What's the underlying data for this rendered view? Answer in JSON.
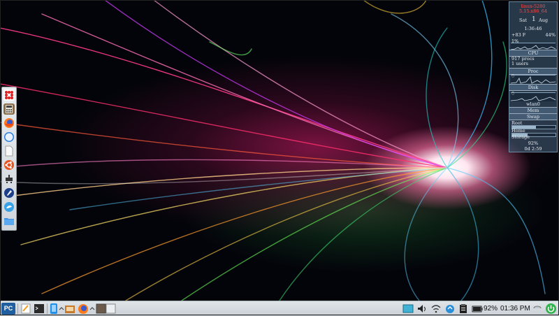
{
  "system_monitor": {
    "hostname": "linux-5280",
    "kernel": "5.15.x86_64",
    "day": "Sat",
    "date_num": "1",
    "month": "Aug",
    "time": "1:36:46",
    "temperature": "+83 F",
    "load": "44%",
    "cpu_pct": "1%",
    "cpu_label": "CPU",
    "procs": "917 procs",
    "users": "1 users",
    "proc_label": "Proc",
    "disk_zero": "0",
    "disk_label": "Disk",
    "net_zero": "0",
    "net_interface": "wlan0",
    "mem_label": "Mem",
    "swap_label": "Swap",
    "fs_root": "Root",
    "fs_home": "Home",
    "fs_storage": "Storage",
    "battery_pct": "92%",
    "uptime": "0d  2:59",
    "fs_levels": {
      "root": 0.55,
      "home": 0.35,
      "storage": 0.7,
      "battery": 0.92
    }
  },
  "dock": {
    "items": [
      {
        "name": "app-grid-icon"
      },
      {
        "name": "calculator-icon"
      },
      {
        "name": "firefox-icon"
      },
      {
        "name": "safari-compass-icon"
      },
      {
        "name": "document-icon"
      },
      {
        "name": "ubuntu-icon"
      },
      {
        "name": "network-icon"
      },
      {
        "name": "rocket-icon"
      },
      {
        "name": "chat-bird-icon"
      },
      {
        "name": "folder-icon"
      }
    ]
  },
  "taskbar": {
    "start_label": "PC",
    "battery_text": "92%",
    "clock": "01:36 PM"
  }
}
